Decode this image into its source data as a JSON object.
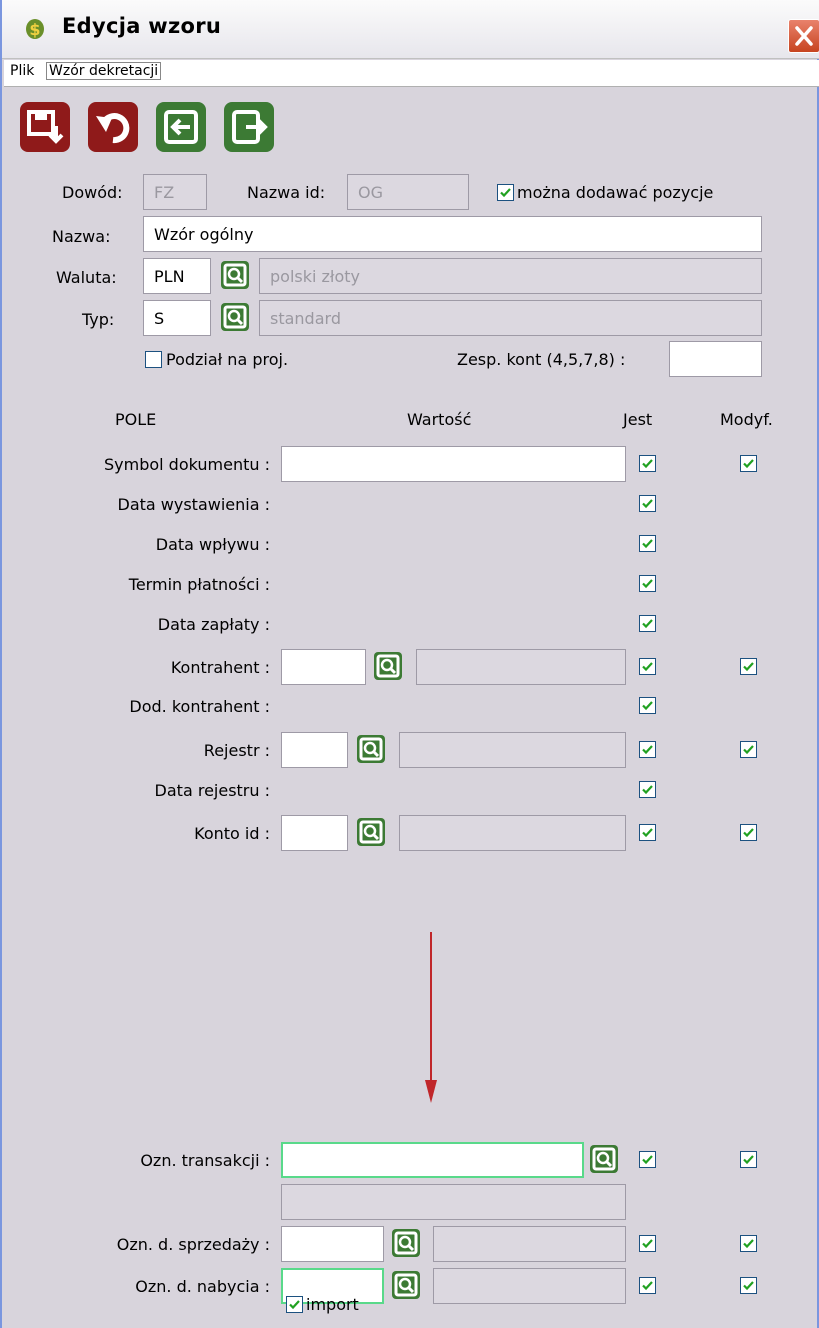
{
  "window": {
    "title": "Edycja wzoru",
    "icon": "dollar-leaf-icon",
    "close_icon": "close-icon"
  },
  "menu": {
    "items": [
      "Plik",
      "Wzór dekretacji"
    ]
  },
  "toolbar": [
    {
      "name": "save-button",
      "icon": "save-icon",
      "color": "#8f1a1a"
    },
    {
      "name": "undo-button",
      "icon": "undo-icon",
      "color": "#8f1a1a"
    },
    {
      "name": "import-button",
      "icon": "enter-icon",
      "color": "#3c7a34"
    },
    {
      "name": "export-button",
      "icon": "exit-icon",
      "color": "#3c7a34"
    }
  ],
  "header": {
    "dowod_label": "Dowód:",
    "dowod_value": "FZ",
    "nazwa_id_label": "Nazwa id:",
    "nazwa_id_value": "OG",
    "add_positions_label": "można dodawać pozycje",
    "add_positions_checked": true,
    "nazwa_label": "Nazwa:",
    "nazwa_value": "Wzór ogólny",
    "waluta_label": "Waluta:",
    "waluta_code": "PLN",
    "waluta_name": "polski złoty",
    "typ_label": "Typ:",
    "typ_code": "S",
    "typ_name": "standard",
    "podzial_label": "Podział na proj.",
    "podzial_checked": false,
    "zesp_label": "Zesp. kont (4,5,7,8) :",
    "zesp_value": ""
  },
  "columns": {
    "pole": "POLE",
    "wartosc": "Wartość",
    "jest": "Jest",
    "modyf": "Modyf."
  },
  "rows": [
    {
      "label": "Symbol dokumentu :",
      "jest": true,
      "modyf": true
    },
    {
      "label": "Data wystawienia :",
      "jest": true
    },
    {
      "label": "Data wpływu :",
      "jest": true
    },
    {
      "label": "Termin płatności :",
      "jest": true
    },
    {
      "label": "Data zapłaty :",
      "jest": true
    },
    {
      "label": "Kontrahent :",
      "jest": true,
      "modyf": true
    },
    {
      "label": "Dod. kontrahent :",
      "jest": true
    },
    {
      "label": "Rejestr :",
      "jest": true,
      "modyf": true
    },
    {
      "label": "Data rejestru :",
      "jest": true
    },
    {
      "label": "Konto id :",
      "jest": true,
      "modyf": true
    },
    {
      "label": "Ozn. transakcji :",
      "jest": true,
      "modyf": true
    },
    {
      "label": "Ozn. d. sprzedaży :",
      "jest": true,
      "modyf": true
    },
    {
      "label": "Ozn. d. nabycia :",
      "jest": true,
      "modyf": true
    }
  ],
  "import": {
    "label": "import",
    "checked": true
  },
  "colors": {
    "accent_green": "#3c7a34",
    "accent_red": "#8f1a1a",
    "focus": "#59d98a",
    "arrow": "#c0262a"
  }
}
